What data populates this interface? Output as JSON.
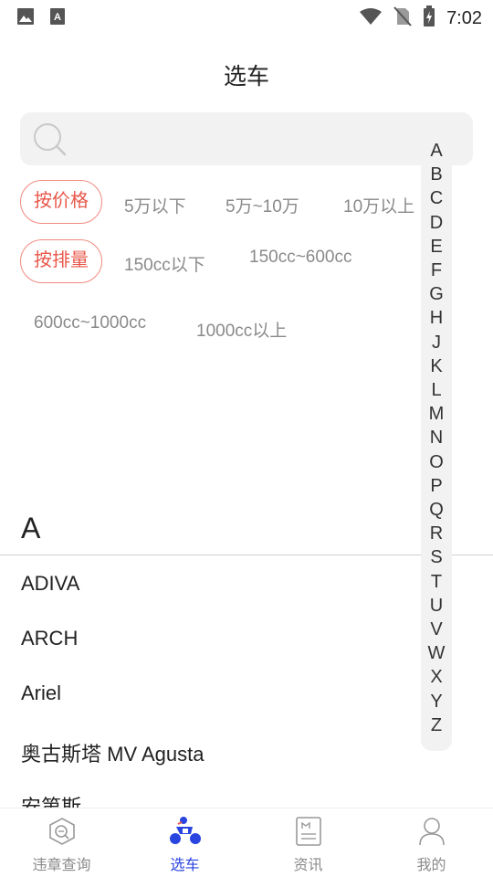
{
  "status_bar": {
    "time": "7:02",
    "notification_icons": [
      "image-icon",
      "a-notification-icon"
    ],
    "system_icons": [
      "wifi-icon",
      "no-sim-icon",
      "battery-charging-icon"
    ]
  },
  "header": {
    "title": "选车"
  },
  "search": {
    "placeholder": ""
  },
  "filters": {
    "price": {
      "label": "按价格",
      "options": [
        "5万以下",
        "5万~10万",
        "10万以上"
      ]
    },
    "displacement": {
      "label": "按排量",
      "options": [
        "150cc以下",
        "150cc~600cc",
        "600cc~1000cc",
        "1000cc以上"
      ]
    }
  },
  "brand_list": {
    "section": "A",
    "items": [
      "ADIVA",
      "ARCH",
      "Ariel",
      "奥古斯塔 MV Agusta",
      "安第斯"
    ]
  },
  "index_letters": [
    "A",
    "B",
    "C",
    "D",
    "E",
    "F",
    "G",
    "H",
    "J",
    "K",
    "L",
    "M",
    "N",
    "O",
    "P",
    "Q",
    "R",
    "S",
    "T",
    "U",
    "V",
    "W",
    "X",
    "Y",
    "Z"
  ],
  "tab_bar": {
    "tabs": [
      {
        "label": "违章查询",
        "icon": "violation-search-icon"
      },
      {
        "label": "选车",
        "icon": "motorcycle-icon",
        "active": true
      },
      {
        "label": "资讯",
        "icon": "news-icon"
      },
      {
        "label": "我的",
        "icon": "profile-icon"
      }
    ]
  },
  "colors": {
    "accent": "#2a44e0",
    "filter_active": "#e8574a",
    "muted_text": "#8a8a8a",
    "panel_bg": "#f2f2f2"
  }
}
